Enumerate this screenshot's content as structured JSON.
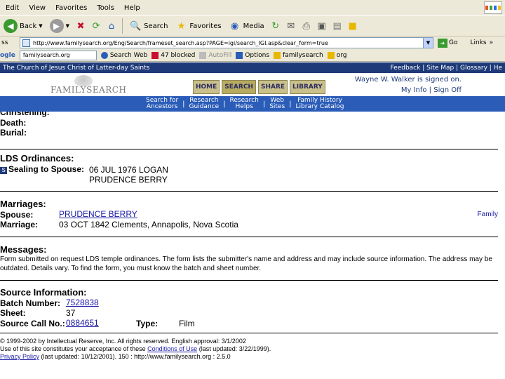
{
  "menu": {
    "items": [
      "Edit",
      "View",
      "Favorites",
      "Tools",
      "Help"
    ]
  },
  "toolbar": {
    "back": "Back",
    "search": "Search",
    "favorites": "Favorites",
    "media": "Media"
  },
  "address": {
    "label": "ss",
    "url": "http://www.familysearch.org/Eng/Search/frameset_search.asp?PAGE=igi/search_IGI.asp&clear_form=true",
    "go": "Go",
    "links": "Links"
  },
  "google": {
    "logo": "ogle",
    "query": "familysearch.org",
    "search_web": "Search Web",
    "blocked": "47 blocked",
    "autofill": "AutoFill",
    "options": "Options",
    "word1": "familysearch",
    "word2": "org"
  },
  "site": {
    "church": "The Church of Jesus Christ of Latter-day Saints",
    "top_links": [
      "Feedback",
      "Site Map",
      "Glossary",
      "He"
    ],
    "logo": "FAMILYSEARCH",
    "tabs": [
      "HOME",
      "SEARCH",
      "SHARE",
      "LIBRARY"
    ],
    "signed_in": "Wayne W. Walker is signed on.",
    "my_info": "My Info",
    "sign_off": "Sign Off",
    "nav": [
      "Search for\nAncestors",
      "Research\nGuidance",
      "Research\nHelps",
      "Web\nSites",
      "Family History\nLibrary Catalog"
    ]
  },
  "record": {
    "christening_label": "Christening:",
    "death_label": "Death:",
    "burial_label": "Burial:",
    "ordinances_title": "LDS Ordinances:",
    "sealing_badge": "S",
    "sealing_label": "Sealing to Spouse:",
    "sealing_value_1": "06 JUL 1976 LOGAN",
    "sealing_value_2": "PRUDENCE BERRY",
    "marriages_title": "Marriages:",
    "spouse_label": "Spouse:",
    "spouse_value": "PRUDENCE BERRY",
    "family_link": "Family",
    "marriage_label": "Marriage:",
    "marriage_value": "03 OCT 1842 Clements, Annapolis, Nova Scotia",
    "messages_title": "Messages:",
    "message_line_1": "Form submitted on request LDS temple ordinances. The form lists the submitter's name and address and may include source information. The address may be",
    "message_line_2": "outdated. Details vary. To find the form, you must know the batch and sheet number.",
    "source_title": "Source Information:",
    "batch_label": "Batch Number:",
    "batch_value": "7528838",
    "sheet_label": "Sheet:",
    "sheet_value": "37",
    "call_label": "Source Call No.:",
    "call_value": "0884651",
    "type_label": "Type:",
    "type_value": "Film"
  },
  "footer": {
    "line_1": "© 1999-2002 by Intellectual Reserve, Inc. All rights reserved. English approval: 3/1/2002",
    "line_2_pre": "Use of this site constitutes your acceptance of these",
    "line_2_link": "Conditions of Use",
    "line_2_post": "(last updated: 3/22/1999).",
    "line_3_link": "Privacy Policy",
    "line_3_post": "(last updated: 10/12/2001). 150 : http://www.familysearch.org : 2.5.0"
  }
}
